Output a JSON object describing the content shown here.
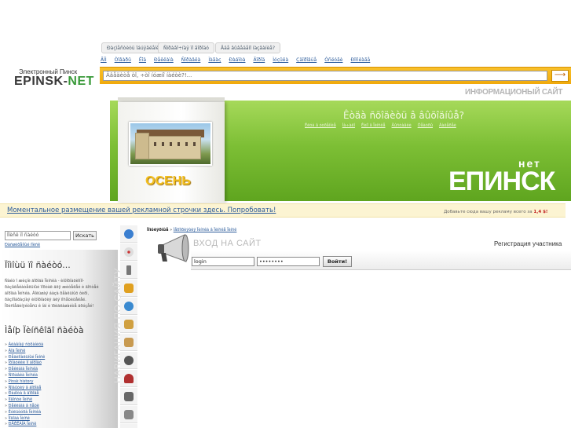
{
  "brand": {
    "tagline": "Электронный Пинск",
    "name_part1": "EPINSK-",
    "name_part2": "NET"
  },
  "top_buttons": [
    "Ðàçìåñòèòü îáúÿâëåíèå",
    "Ñïðàâî÷íàÿ ïî ãîðîäó",
    "Ãäå âûâåäåíî íàçâàíèå?"
  ],
  "categories": [
    "ÃÎÌ",
    "Òîâàðû",
    "Ëîä",
    "Ðåêëàìà",
    "Ñïðàâêà",
    "Ìàãàç",
    "Ðàáîòà",
    "Ãîðîä",
    "Ìóçûêà",
    "Çäîðîâüå",
    "Óñëóãè",
    "Ðîñëàãå"
  ],
  "search": {
    "value": "Ââåäèòå òî, ÷òî íóæíî íàéòè?!...",
    "go_icon": "right-arrow-icon"
  },
  "info_title": "ИНФОРМАЦИОНЫЙ САЙТ",
  "hero": {
    "season_label": "ОСЕНЬ",
    "heading": "Êòäà ñõîäèòü â âûõîäíûå?",
    "links": [
      "Êëóá â óòðåííèå",
      "Íà÷àëî",
      "Êèíî â Ïèíñêå",
      "Âûñòàâêè",
      "Òåàòðû",
      "Ãàëåðåè"
    ],
    "brand_small": "нет",
    "brand_big": "ЕПИНСК"
  },
  "ad_strip": {
    "text": "Моментальное размещение вашей рекламной строчки здесь. Попробовать!",
    "right_text": "Добавьте сюда вашу рекламу всего за",
    "price": "1,4 $!"
  },
  "left": {
    "search_placeholder": "Ïîèñê ïî ñàéòó",
    "search_button": "Искать",
    "extended_search": "Ðàñøèðåííûé ïîèñê",
    "heading1": "Ïîìîùü ïî ñàéòó...",
    "text": "Ñàéò î æèçíè ãîðîäà Ïèíñêà - èíôîðìàöèîííî-ðàçâëåêàòåëüíûé ïîðòàë äëÿ æèòåëåé è ãîñòåé ãîðîäà Ïèíñêà. Áîëüøàÿ áàçà ðåàëüíûõ ôèðì, ðàçíîîáðàçíàÿ èíôîðìàöèÿ äëÿ ïîñåòèòåëåé. Ïðèñîåäèíÿéòåñü ê íàì è ïðèãëàøàéòå äðóçåé!",
    "heading2": "Ìåíþ Ïèíñêîãî ñàéòà",
    "nav_items": [
      "Ãëàâíàÿ ñòðàíèöà",
      "Ãîä Ïèíñê",
      "Ðåãèîíàëüíûé Ïèíñê",
      "Ïðîãóëêè ïî ãîðîäó",
      "Ðåêëàìà Ïèíñêà",
      "Ñïðàâêà Ïèíñêà",
      "Pinsk history",
      "Ñîáûòèÿ â ãîðîäå",
      "Ðàáîòà â ãîðîäå",
      "Íîâîñòè Ïèíñê",
      "Ðåêëàìà â ñåòè",
      "Êóëüòóðà Ïèíñêà",
      "Ïîãîäà Ïèíñê",
      "ÐÅÊËÀÌÀ Ïèíñê"
    ],
    "vertical_nav": "НАВИГАЦИЯ ПО САЙТУ"
  },
  "icon_bar": [
    "globe-icon",
    "compass-icon",
    "tower-icon",
    "people-icon",
    "user-icon",
    "gift-icon",
    "map-icon",
    "car-icon",
    "hat-icon",
    "tools-icon",
    "file-icon",
    "printer-icon"
  ],
  "content": {
    "breadcrumb": [
      "Ïîïóëÿðíûå",
      "Ìåðîïðèÿòèÿ Ïèíñêà â Ïèíñêå Ïèíñê"
    ],
    "breadcrumb_sep": "»",
    "registration": "Регистрация участника",
    "login_title": "ВХОД НА САЙТ",
    "login_value": "login",
    "password_value": "••••••••",
    "login_button": "Войти!"
  }
}
